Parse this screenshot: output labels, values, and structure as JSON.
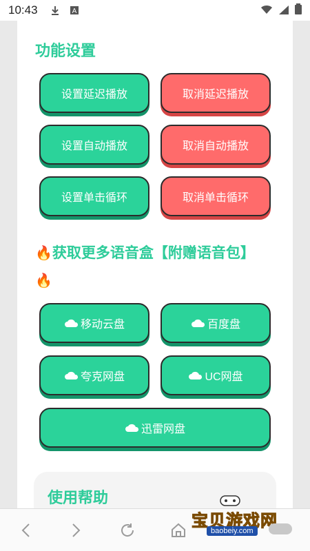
{
  "status_bar": {
    "time": "10:43",
    "icons": [
      "download-icon",
      "a-box-icon",
      "wifi-icon",
      "signal-icon",
      "battery-icon"
    ]
  },
  "settings": {
    "title": "功能设置",
    "buttons": [
      {
        "label": "设置延迟播放",
        "color": "#2bd39a"
      },
      {
        "label": "取消延迟播放",
        "color": "#ff6b6b"
      },
      {
        "label": "设置自动播放",
        "color": "#2bd39a"
      },
      {
        "label": "取消自动播放",
        "color": "#ff6b6b"
      },
      {
        "label": "设置单击循环",
        "color": "#2bd39a"
      },
      {
        "label": "取消单击循环",
        "color": "#ff6b6b"
      }
    ]
  },
  "promo": {
    "title": "获取更多语音盒【附赠语音包】",
    "icon": "fire-icon",
    "buttons": [
      {
        "label": "移动云盘",
        "icon": "cloud-icon"
      },
      {
        "label": "百度盘",
        "icon": "cloud-icon"
      },
      {
        "label": "夸克网盘",
        "icon": "cloud-icon"
      },
      {
        "label": "UC网盘",
        "icon": "cloud-icon"
      },
      {
        "label": "迅雷网盘",
        "icon": "cloud-icon"
      }
    ]
  },
  "help": {
    "title": "使用帮助"
  },
  "watermark": {
    "text": "宝贝游戏网",
    "url": "baobeiy.com"
  },
  "nav": [
    "back-icon",
    "forward-icon",
    "refresh-icon",
    "home-icon"
  ]
}
